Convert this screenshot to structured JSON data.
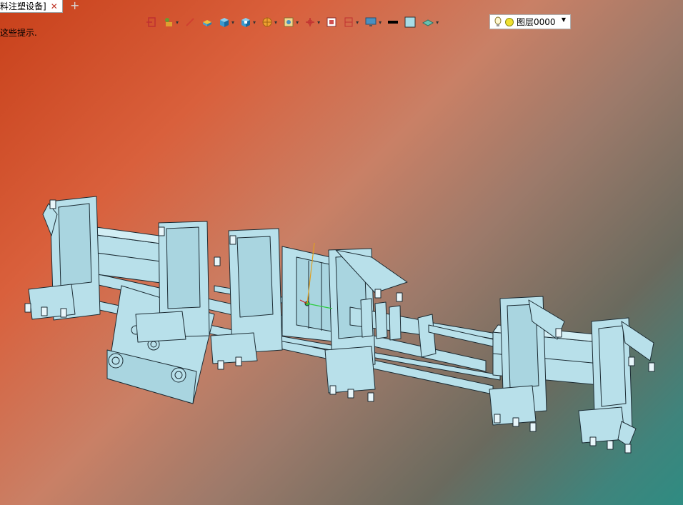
{
  "tab": {
    "title": "料注塑设备]",
    "close": "✕",
    "add": "+"
  },
  "hint": "这些提示.",
  "toolbar": {
    "items": [
      "exit-sketch-icon",
      "feature-icon",
      "pen-icon",
      "extrude-icon",
      "box-icon",
      "shell-icon",
      "sphere-icon",
      "view-icon",
      "axis-icon",
      "frame-icon",
      "section-icon",
      "monitor-icon",
      "line-weight-icon",
      "color-fill-icon",
      "layer-style-icon"
    ],
    "fill_color": "#a8dce6"
  },
  "layer": {
    "label": "图层0000"
  },
  "colors": {
    "model": "#b8e0ea",
    "outline": "#1c2c34"
  }
}
